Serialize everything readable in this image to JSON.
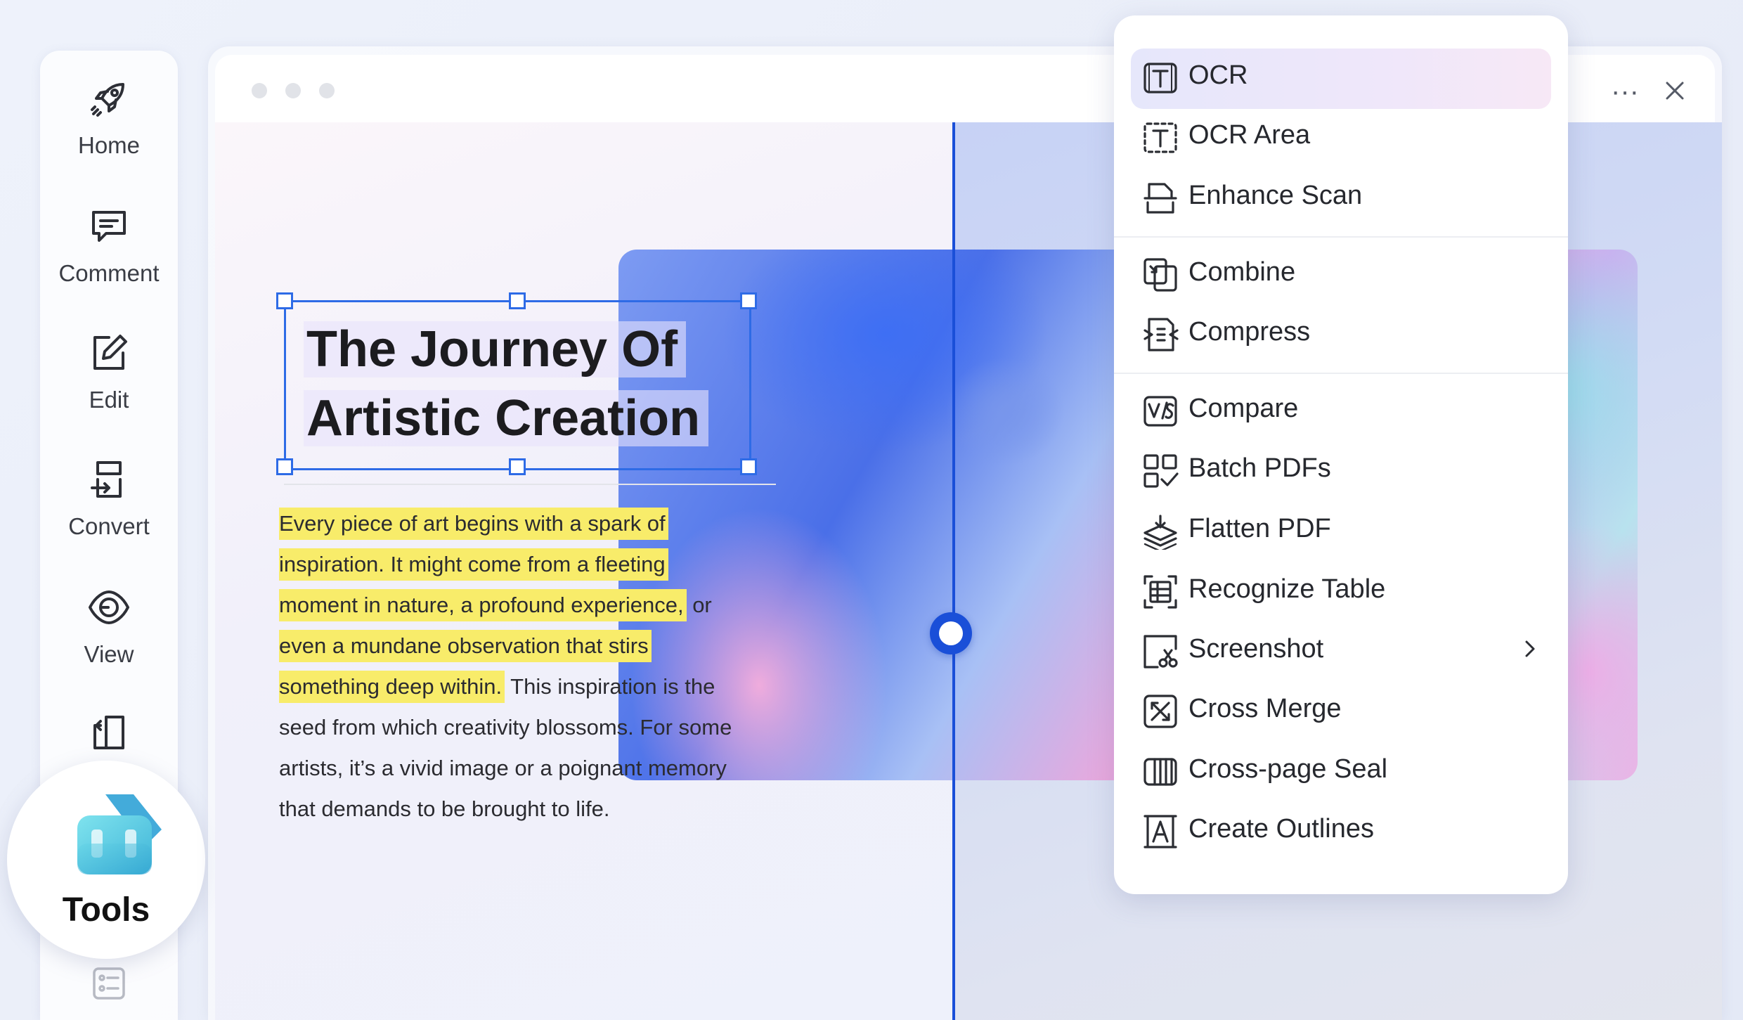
{
  "sidebar": {
    "items": [
      {
        "label": "Home",
        "icon": "rocket-icon"
      },
      {
        "label": "Comment",
        "icon": "comment-icon"
      },
      {
        "label": "Edit",
        "icon": "edit-icon"
      },
      {
        "label": "Convert",
        "icon": "convert-icon"
      },
      {
        "label": "View",
        "icon": "eye-icon"
      },
      {
        "label": "",
        "icon": "page-icon"
      }
    ],
    "tools": {
      "label": "Tools",
      "icon": "toolbox-icon"
    }
  },
  "document": {
    "title_line1": "The Journey Of",
    "title_line2": "Artistic Creation",
    "body": {
      "hl1": "Every piece of art begins with a spark of",
      "hl2": "inspiration. It might come from a fleeting",
      "hl3": "moment in nature, a profound experience,",
      "tail3": " or",
      "hl4": "even a mundane observation that stirs",
      "hl5": "something deep within.",
      "tail5": " This inspiration is the",
      "line6": "seed from which creativity blossoms. For some",
      "line7": "artists, it’s a vivid image or a poignant memory",
      "line8": "that demands to be brought to life."
    }
  },
  "menu": {
    "items": [
      {
        "label": "OCR",
        "icon": "ocr-icon",
        "active": true
      },
      {
        "label": "OCR Area",
        "icon": "ocr-area-icon"
      },
      {
        "label": "Enhance Scan",
        "icon": "scan-icon"
      },
      {
        "label": "Combine",
        "icon": "combine-icon"
      },
      {
        "label": "Compress",
        "icon": "compress-icon"
      },
      {
        "label": "Compare",
        "icon": "compare-icon"
      },
      {
        "label": "Batch PDFs",
        "icon": "batch-icon"
      },
      {
        "label": "Flatten PDF",
        "icon": "flatten-icon"
      },
      {
        "label": "Recognize Table",
        "icon": "table-icon"
      },
      {
        "label": "Screenshot",
        "icon": "screenshot-icon",
        "has_submenu": true
      },
      {
        "label": "Cross Merge",
        "icon": "cross-merge-icon"
      },
      {
        "label": "Cross-page Seal",
        "icon": "seal-icon"
      },
      {
        "label": "Create Outlines",
        "icon": "outline-icon"
      }
    ]
  },
  "window_controls": {
    "more": "···",
    "close": "×"
  },
  "colors": {
    "accent": "#2e6be6",
    "highlight": "#f8ec6a",
    "compare_line": "#1a4fd8"
  }
}
